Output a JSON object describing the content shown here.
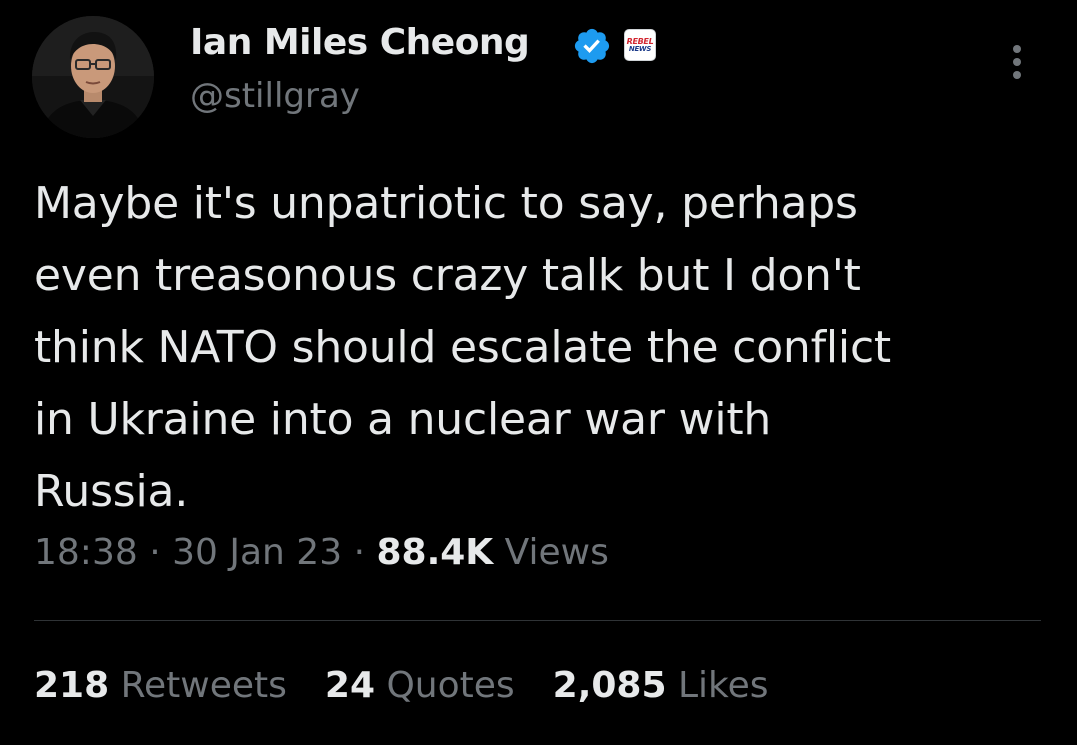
{
  "author": {
    "display_name": "Ian Miles Cheong",
    "handle": "@stillgray",
    "verified": true,
    "affiliation_badge": {
      "line1": "REBEL",
      "line2": "NEWS",
      "colors": {
        "line1": "#d22630",
        "line2": "#1b3a8a"
      }
    }
  },
  "tweet": {
    "text": "Maybe it's unpatriotic to say, perhaps\neven treasonous crazy talk but I don't\nthink NATO should escalate the conflict\nin Ukraine into a nuclear war with\nRussia."
  },
  "meta": {
    "time": "18:38",
    "separator": "·",
    "date": "30 Jan 23",
    "views_count": "88.4K",
    "views_label": "Views"
  },
  "stats": {
    "retweets_count": "218",
    "retweets_label": "Retweets",
    "quotes_count": "24",
    "quotes_label": "Quotes",
    "likes_count": "2,085",
    "likes_label": "Likes"
  },
  "icons": {
    "verified": "verified-check-icon",
    "more": "more-vertical-icon"
  },
  "colors": {
    "background": "#000000",
    "primary_text": "#e7e9ea",
    "secondary_text": "#71767b",
    "verified_blue": "#1d9bf0",
    "divider": "#2f3336"
  }
}
